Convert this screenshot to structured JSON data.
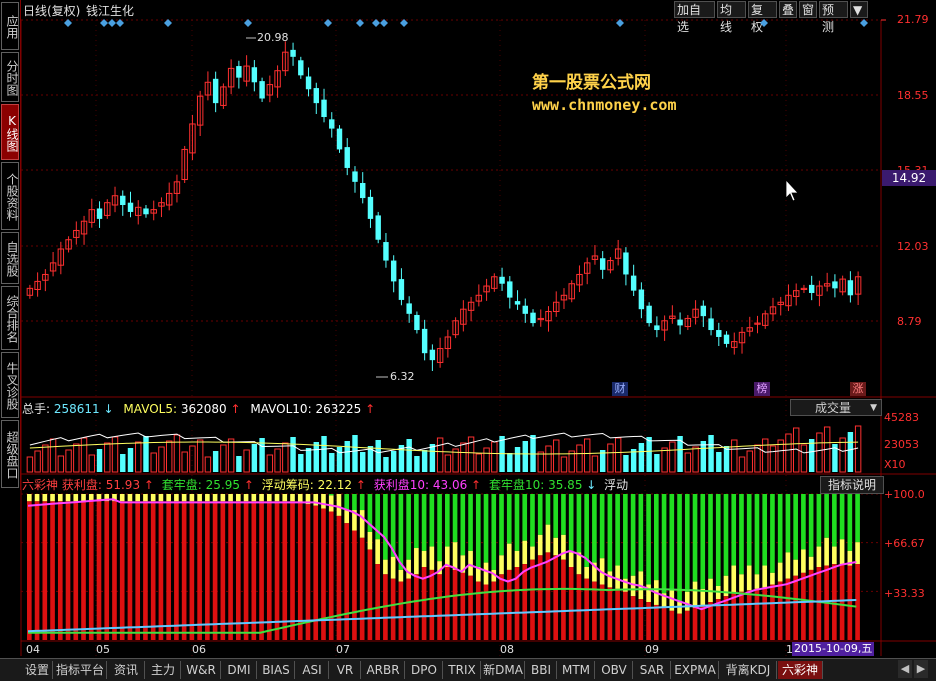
{
  "sidebar": {
    "tabs": [
      {
        "label": "应用",
        "active": false
      },
      {
        "label": "分时图",
        "active": false
      },
      {
        "label": "K线图",
        "active": true
      },
      {
        "label": "个股资料",
        "active": false
      },
      {
        "label": "自选股",
        "active": false
      },
      {
        "label": "综合排名",
        "active": false
      },
      {
        "label": "牛叉诊股",
        "active": false
      },
      {
        "label": "超级盘口",
        "active": false
      }
    ]
  },
  "header": {
    "period": "日线(复权)",
    "stock_name": "钱江生化",
    "buttons": [
      "加自选",
      "均线",
      "复权",
      "叠",
      "窗",
      "预测"
    ],
    "menu_arrow": "▼"
  },
  "watermark": {
    "line1": "第一股票公式网",
    "line2": "www.chnmoney.com"
  },
  "price_axis": {
    "labels": [
      "21.79",
      "18.55",
      "15.31",
      "12.03",
      "8.79"
    ],
    "current_price": "14.92",
    "high_label": "20.98",
    "low_label": "6.32"
  },
  "markers": {
    "cai": "财",
    "bang": "榜",
    "zhang": "涨"
  },
  "volume_panel": {
    "total_label": "总手:",
    "total_value": "258611",
    "mavol5_label": "MAVOL5:",
    "mavol5_value": "362080",
    "mavol10_label": "MAVOL10:",
    "mavol10_value": "263225",
    "dropdown": "成交量",
    "axis": [
      "45283",
      "23053",
      "X10"
    ]
  },
  "indicator_panel": {
    "name": "六彩神",
    "items": [
      {
        "label": "获利盘:",
        "value": "51.93"
      },
      {
        "label": "套牢盘:",
        "value": "25.95"
      },
      {
        "label": "浮动筹码:",
        "value": "22.12"
      },
      {
        "label": "获利盘10:",
        "value": "43.06"
      },
      {
        "label": "套牢盘10:",
        "value": "35.85"
      },
      {
        "label": "浮动",
        "value": ""
      }
    ],
    "help_button": "指标说明",
    "axis": [
      "+100.0",
      "+66.67",
      "+33.33"
    ]
  },
  "date_axis": {
    "months": [
      "04",
      "05",
      "06",
      "07",
      "08",
      "09",
      "1"
    ],
    "cursor_date": "2015-10-09,五"
  },
  "bottom_tabs": [
    "设置",
    "指标平台",
    "资讯",
    "主力",
    "W&R",
    "DMI",
    "BIAS",
    "ASI",
    "VR",
    "ARBR",
    "DPO",
    "TRIX",
    "新DMA",
    "BBI",
    "MTM",
    "OBV",
    "SAR",
    "EXPMA",
    "背离KDJ",
    "六彩神"
  ],
  "chart_data": [
    {
      "type": "candlestick",
      "title": "钱江生化 日线(复权)",
      "y_ticks": [
        21.79,
        18.55,
        15.31,
        12.03,
        8.79
      ],
      "ylim": [
        5.5,
        22.5
      ],
      "current": 14.92,
      "high": 20.98,
      "low": 6.32,
      "close": [
        10.2,
        10.5,
        10.8,
        11.3,
        11.9,
        12.3,
        12.7,
        13.1,
        13.6,
        13.2,
        13.9,
        14.2,
        13.8,
        13.5,
        13.7,
        13.4,
        13.6,
        13.9,
        14.3,
        14.8,
        16.2,
        17.3,
        18.5,
        19.1,
        18.2,
        18.9,
        19.7,
        19.3,
        19.8,
        19.1,
        18.4,
        19.0,
        19.6,
        20.4,
        20.2,
        19.4,
        18.8,
        18.2,
        17.6,
        17.1,
        16.2,
        15.4,
        14.8,
        14.1,
        13.2,
        12.3,
        11.4,
        10.5,
        9.7,
        9.1,
        8.4,
        7.4,
        7.1,
        7.6,
        8.1,
        8.8,
        9.3,
        9.6,
        9.9,
        10.3,
        10.7,
        10.4,
        9.8,
        9.5,
        9.1,
        8.7,
        8.9,
        9.2,
        9.6,
        9.9,
        10.4,
        10.8,
        11.3,
        11.6,
        11.0,
        11.4,
        11.9,
        10.8,
        10.1,
        9.3,
        8.7,
        8.4,
        8.8,
        9.0,
        8.6,
        8.9,
        9.3,
        9.0,
        8.4,
        8.1,
        7.8,
        7.9,
        8.3,
        8.5,
        8.7,
        9.1,
        9.4,
        9.6,
        9.9,
        10.1,
        10.2,
        10.0,
        10.3,
        10.4,
        10.2,
        10.6,
        9.9,
        10.7
      ]
    },
    {
      "type": "bar",
      "title": "成交量",
      "y_ticks": [
        45283,
        23053
      ],
      "unit": "X10",
      "series": [
        {
          "name": "总手",
          "last": 258611
        },
        {
          "name": "MAVOL5",
          "last": 362080
        },
        {
          "name": "MAVOL10",
          "last": 263225
        }
      ]
    },
    {
      "type": "area",
      "title": "六彩神",
      "y_ticks": [
        100.0,
        66.67,
        33.33
      ],
      "ylim": [
        0,
        100
      ],
      "series": [
        {
          "name": "获利盘",
          "last": 51.93
        },
        {
          "name": "套牢盘",
          "last": 25.95
        },
        {
          "name": "浮动筹码",
          "last": 22.12
        },
        {
          "name": "获利盘10",
          "last": 43.06
        },
        {
          "name": "套牢盘10",
          "last": 35.85
        }
      ],
      "red_profit": [
        95,
        95,
        95,
        95,
        95,
        95,
        95,
        95,
        95,
        95,
        95,
        95,
        95,
        95,
        95,
        95,
        95,
        95,
        95,
        95,
        95,
        95,
        95,
        95,
        95,
        95,
        95,
        95,
        95,
        95,
        95,
        95,
        95,
        95,
        95,
        94,
        93,
        92,
        90,
        88,
        85,
        80,
        75,
        70,
        62,
        52,
        45,
        42,
        40,
        42,
        45,
        50,
        48,
        45,
        50,
        48,
        46,
        44,
        40,
        38,
        40,
        45,
        48,
        50,
        52,
        55,
        58,
        60,
        58,
        55,
        50,
        45,
        42,
        40,
        38,
        36,
        35,
        33,
        30,
        28,
        26,
        24,
        22,
        20,
        18,
        20,
        22,
        24,
        26,
        28,
        30,
        32,
        33,
        34,
        35,
        36,
        38,
        40,
        42,
        44,
        46,
        48,
        50,
        51,
        52,
        52,
        51,
        52
      ]
    }
  ]
}
